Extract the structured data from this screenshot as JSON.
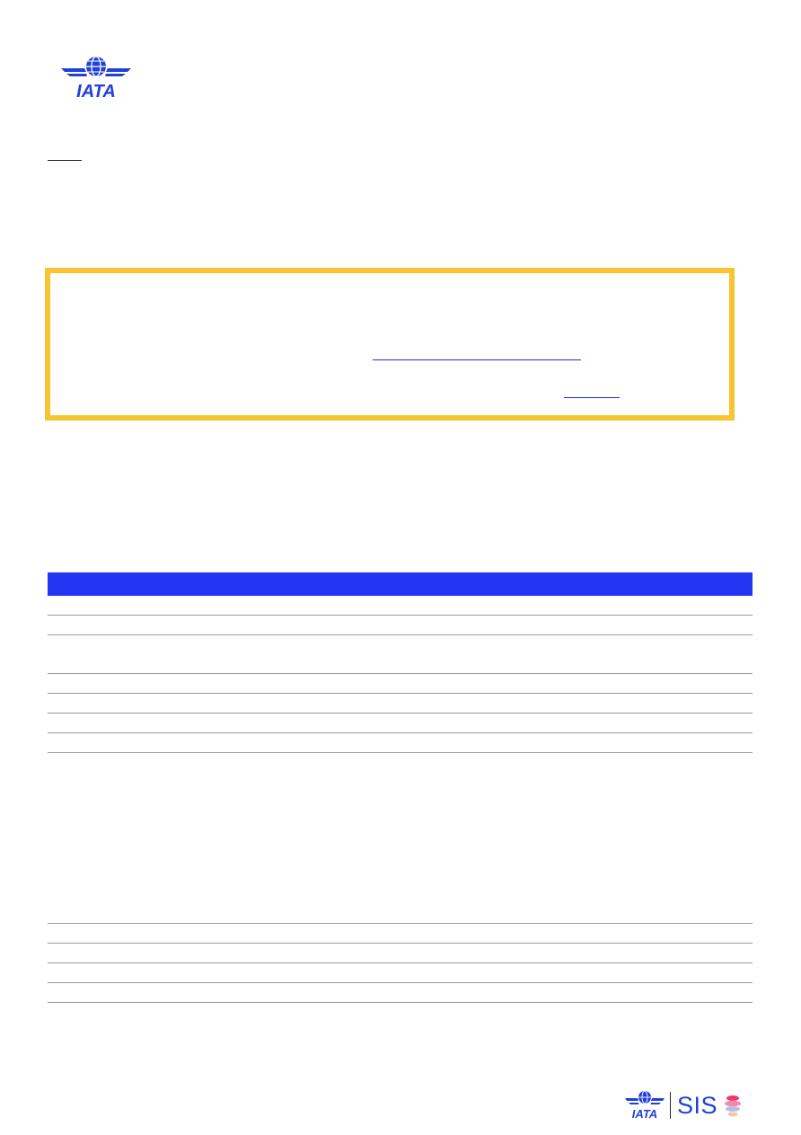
{
  "header": {
    "logo_icon": "iata-logo-icon",
    "logo_text": "IATA",
    "short_link": ""
  },
  "notice": {
    "border_color": "#f6c531",
    "link_1": "",
    "link_2": ""
  },
  "table": {
    "header_color": "#2536f2",
    "header_text": "",
    "rows": [
      {
        "text": ""
      },
      {
        "text": ""
      },
      {
        "text": ""
      },
      {
        "text": ""
      },
      {
        "text": ""
      },
      {
        "text": ""
      },
      {
        "text": ""
      },
      {
        "text": ""
      },
      {
        "text": ""
      },
      {
        "text": ""
      },
      {
        "text": ""
      },
      {
        "text": ""
      }
    ]
  },
  "footer": {
    "logo_text": "IATA",
    "product_name": "SIS",
    "sis_icon": "sis-globe-icon"
  }
}
